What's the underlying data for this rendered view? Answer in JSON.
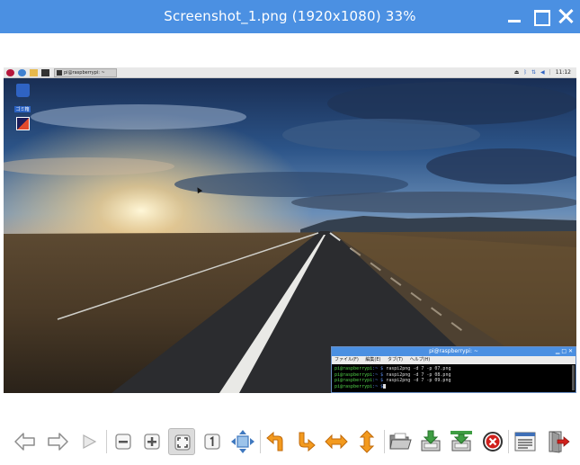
{
  "window": {
    "title": "Screenshot_1.png (1920x1080) 33%"
  },
  "screenshot": {
    "panel": {
      "task_label": "pi@raspberrypi: ~",
      "clock": "11:12",
      "icons": [
        "raspberry-menu-icon",
        "web-browser-icon",
        "file-manager-icon",
        "terminal-icon"
      ],
      "tray_icons": [
        "eject-icon",
        "bluetooth-icon",
        "network-icon",
        "volume-icon"
      ]
    },
    "desktop": {
      "trash_label": "ゴミ箱",
      "app_label": ""
    },
    "terminal": {
      "title": "pi@raspberrypi: ~",
      "menu": [
        "ファイル(F)",
        "編集(E)",
        "タブ(T)",
        "ヘルプ(H)"
      ],
      "lines": [
        {
          "prompt": "pi@raspberrypi",
          "path": ":~ $",
          "cmd": " raspi2png -d 7 -p 07.png"
        },
        {
          "prompt": "pi@raspberrypi",
          "path": ":~ $",
          "cmd": " raspi2png -d 7 -p 08.png"
        },
        {
          "prompt": "pi@raspberrypi",
          "path": ":~ $",
          "cmd": " raspi2png -d 7 -p 09.png"
        },
        {
          "prompt": "pi@raspberrypi",
          "path": ":~ $",
          "cmd": ""
        }
      ]
    }
  },
  "toolbar": {
    "buttons": [
      {
        "name": "previous-image-button",
        "icon": "arrow-left-icon"
      },
      {
        "name": "next-image-button",
        "icon": "arrow-right-icon"
      },
      {
        "name": "slideshow-button",
        "icon": "play-icon"
      },
      {
        "name": "zoom-out-button",
        "icon": "zoom-out-icon"
      },
      {
        "name": "zoom-in-button",
        "icon": "zoom-in-icon"
      },
      {
        "name": "fit-window-button",
        "icon": "fit-window-icon",
        "active": true
      },
      {
        "name": "original-size-button",
        "icon": "original-size-icon"
      },
      {
        "name": "fullscreen-button",
        "icon": "fullscreen-icon"
      },
      {
        "name": "rotate-left-button",
        "icon": "rotate-left-icon"
      },
      {
        "name": "rotate-right-button",
        "icon": "rotate-right-icon"
      },
      {
        "name": "flip-horizontal-button",
        "icon": "flip-horizontal-icon"
      },
      {
        "name": "flip-vertical-button",
        "icon": "flip-vertical-icon"
      },
      {
        "name": "open-file-button",
        "icon": "folder-open-icon"
      },
      {
        "name": "save-file-button",
        "icon": "save-icon"
      },
      {
        "name": "save-as-button",
        "icon": "save-as-icon"
      },
      {
        "name": "delete-file-button",
        "icon": "delete-icon"
      },
      {
        "name": "preferences-button",
        "icon": "preferences-icon"
      },
      {
        "name": "quit-button",
        "icon": "exit-icon"
      }
    ],
    "colors": {
      "accent": "#4b90e2",
      "orange": "#f39a1e",
      "green": "#3f9d43",
      "red": "#d0201c",
      "gray_icon": "#8c8c8c"
    }
  }
}
